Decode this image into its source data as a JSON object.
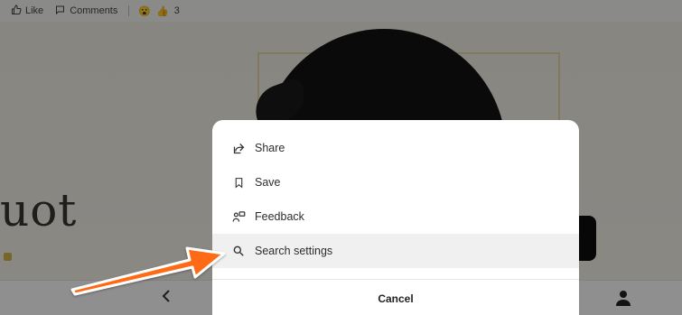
{
  "reactions": {
    "like_label": "Like",
    "comments_label": "Comments",
    "reaction_count": "3"
  },
  "hero": {
    "quote_fragment": "uot"
  },
  "sheet": {
    "items": [
      {
        "label": "Share",
        "icon": "share-icon"
      },
      {
        "label": "Save",
        "icon": "bookmark-icon"
      },
      {
        "label": "Feedback",
        "icon": "feedback-icon"
      },
      {
        "label": "Search settings",
        "icon": "search-icon",
        "highlighted": true
      }
    ],
    "cancel_label": "Cancel"
  },
  "colors": {
    "arrow": "#ff6a13",
    "scrim": "rgba(0,0,0,0.44)",
    "highlight_row": "#f0f0f0"
  }
}
